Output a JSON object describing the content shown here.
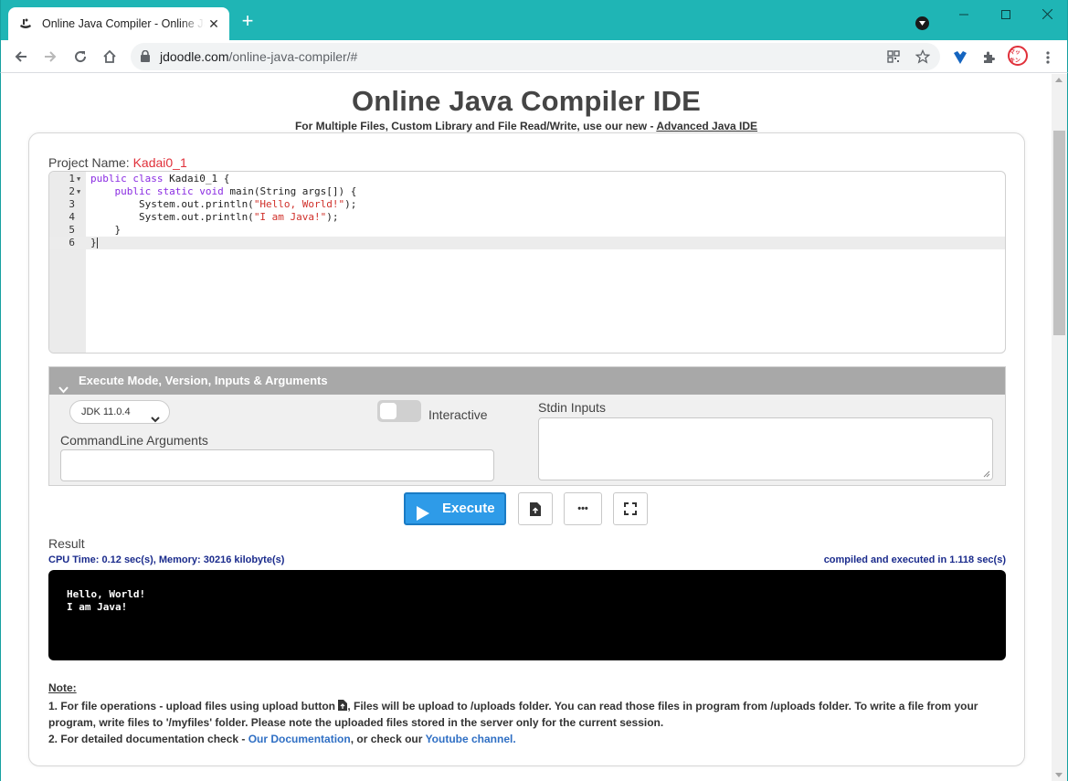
{
  "browser": {
    "tab_title": "Online Java Compiler - Online Jav",
    "new_tab": "+",
    "url_host": "jdoodle.com",
    "url_path": "/online-java-compiler/#",
    "extension_badge": "マッキン"
  },
  "page": {
    "title": "Online Java Compiler IDE",
    "subtitle_prefix": "For Multiple Files, Custom Library and File Read/Write, use our new -",
    "subtitle_link": "Advanced Java IDE"
  },
  "project": {
    "label": "Project Name:",
    "name": "Kadai0_1"
  },
  "editor": {
    "line_numbers": [
      "1",
      "2",
      "3",
      "4",
      "5",
      "6"
    ]
  },
  "exec_panel": {
    "header": "Execute Mode, Version, Inputs & Arguments",
    "jdk_version": "JDK 11.0.4",
    "interactive_label": "Interactive",
    "stdin_label": "Stdin Inputs",
    "cmdline_label": "CommandLine Arguments"
  },
  "actions": {
    "execute_label": "Execute",
    "more_label": "•••"
  },
  "result": {
    "label": "Result",
    "cpu_time": "CPU Time: 0.12 sec(s), Memory: 30216 kilobyte(s)",
    "compiled": "compiled and executed in 1.118 sec(s)",
    "output_line1": "Hello, World!",
    "output_line2": "I am Java!"
  },
  "notes": {
    "heading": "Note:",
    "line1a": "1. For file operations - upload files using upload button",
    "line1b": ", Files will be upload to /uploads folder. You can read those files in program from /uploads folder. To write a file from your",
    "line1c": "program, write files to '/myfiles' folder. Please note the uploaded files stored in the server only for the current session.",
    "line2a": "2. For detailed documentation check -",
    "line2_link1": "Our Documentation",
    "line2b": ", or check our",
    "line2_link2": "Youtube channel."
  },
  "colors": {
    "titlebar": "#1fb5b5",
    "project_name": "#e0303a",
    "execute_button": "#2e9be8",
    "link": "#2f6fc4",
    "stats_text": "#1a2b8c"
  }
}
